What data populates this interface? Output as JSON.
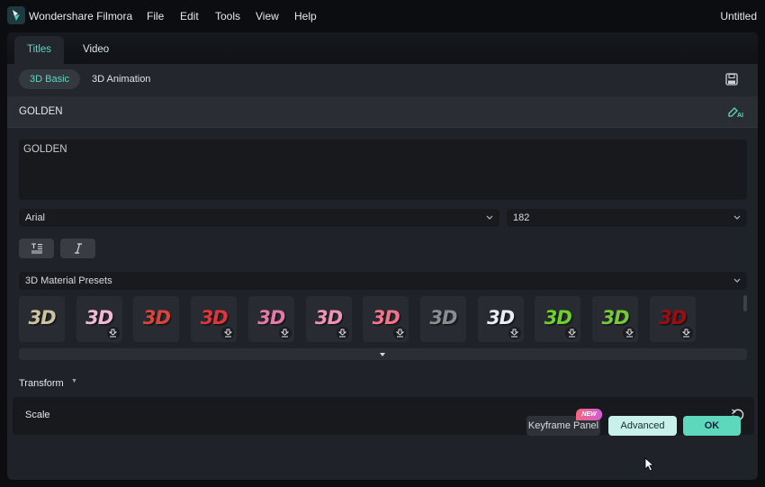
{
  "app": {
    "name": "Wondershare Filmora",
    "document_title": "Untitled",
    "menu": [
      "File",
      "Edit",
      "Tools",
      "View",
      "Help"
    ]
  },
  "dialog": {
    "tabs": [
      {
        "label": "Titles",
        "active": true
      },
      {
        "label": "Video",
        "active": false
      }
    ],
    "subtabs": [
      {
        "label": "3D Basic",
        "active": true
      },
      {
        "label": "3D Animation",
        "active": false
      }
    ],
    "section_title": "GOLDEN",
    "text_value": "GOLDEN",
    "font": {
      "value": "Arial"
    },
    "font_size": {
      "value": "182"
    },
    "format_buttons": [
      "text-align-icon",
      "italic-icon"
    ],
    "material_presets": {
      "label": "3D Material Presets",
      "items": [
        {
          "label": "3D",
          "style": "gold-stone",
          "downloadable": false,
          "color": "#cbc3a0"
        },
        {
          "label": "3D",
          "style": "pink-cream",
          "downloadable": true,
          "color": "#f1b8d8"
        },
        {
          "label": "3D",
          "style": "red-glossy",
          "downloadable": false,
          "color": "#d9443c"
        },
        {
          "label": "3D",
          "style": "red-grid",
          "downloadable": true,
          "color": "#e0353d"
        },
        {
          "label": "3D",
          "style": "pink-bubble",
          "downloadable": true,
          "color": "#e57aa6"
        },
        {
          "label": "3D",
          "style": "rose-soft",
          "downloadable": true,
          "color": "#ee93b4"
        },
        {
          "label": "3D",
          "style": "coral-gradient",
          "downloadable": true,
          "color": "#f2738a"
        },
        {
          "label": "3D",
          "style": "grey-metal",
          "downloadable": false,
          "color": "#8a8c90"
        },
        {
          "label": "3D",
          "style": "white-ice",
          "downloadable": true,
          "color": "#e8eef5"
        },
        {
          "label": "3D",
          "style": "green-lime",
          "downloadable": true,
          "color": "#6fd02a"
        },
        {
          "label": "3D",
          "style": "green-grass",
          "downloadable": true,
          "color": "#77c83a"
        },
        {
          "label": "3D",
          "style": "dark-red",
          "downloadable": true,
          "color": "#9b0d12"
        }
      ]
    },
    "transform": {
      "label": "Transform",
      "scale_label": "Scale"
    },
    "footer": {
      "keyframe_label": "Keyframe Panel",
      "new_badge": "NEW",
      "advanced_label": "Advanced",
      "ok_label": "OK"
    }
  },
  "colors": {
    "accent": "#5fd6c2",
    "ok_button": "#5dd8bd",
    "advanced_button": "#c7f1ea"
  }
}
